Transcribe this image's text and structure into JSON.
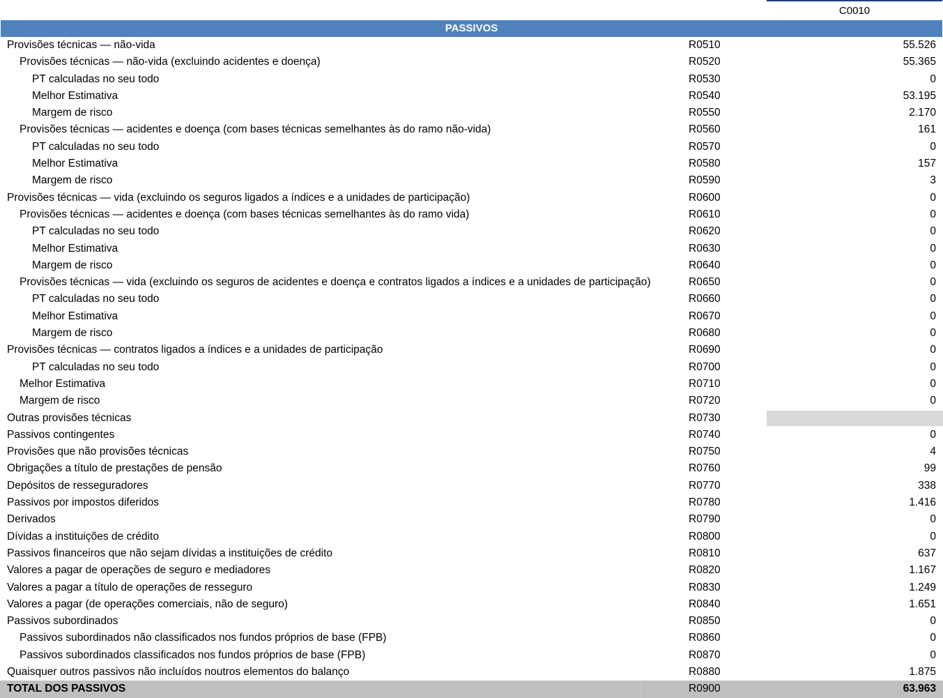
{
  "column_code": "C0010",
  "section_title": "PASSIVOS",
  "rows": [
    {
      "label": "Provisões técnicas — não-vida",
      "level": 0,
      "code": "R0510",
      "value": "55.526"
    },
    {
      "label": "Provisões técnicas — não-vida (excluindo acidentes e doença)",
      "level": 1,
      "code": "R0520",
      "value": "55.365"
    },
    {
      "label": "PT calculadas no seu todo",
      "level": 2,
      "code": "R0530",
      "value": "0"
    },
    {
      "label": "Melhor Estimativa",
      "level": 2,
      "code": "R0540",
      "value": "53.195"
    },
    {
      "label": "Margem de risco",
      "level": 2,
      "code": "R0550",
      "value": "2.170"
    },
    {
      "label": "Provisões técnicas — acidentes e doença (com bases técnicas semelhantes às do ramo não-vida)",
      "level": 1,
      "code": "R0560",
      "value": "161"
    },
    {
      "label": "PT calculadas no seu todo",
      "level": 2,
      "code": "R0570",
      "value": "0"
    },
    {
      "label": "Melhor Estimativa",
      "level": 2,
      "code": "R0580",
      "value": "157"
    },
    {
      "label": "Margem de risco",
      "level": 2,
      "code": "R0590",
      "value": "3"
    },
    {
      "label": "Provisões técnicas — vida (excluindo os seguros ligados a índices e a unidades de participação)",
      "level": 0,
      "code": "R0600",
      "value": "0"
    },
    {
      "label": "Provisões técnicas — acidentes e doença (com bases técnicas semelhantes às do ramo vida)",
      "level": 1,
      "code": "R0610",
      "value": "0"
    },
    {
      "label": "PT calculadas no seu todo",
      "level": 2,
      "code": "R0620",
      "value": "0"
    },
    {
      "label": "Melhor Estimativa",
      "level": 2,
      "code": "R0630",
      "value": "0"
    },
    {
      "label": "Margem de risco",
      "level": 2,
      "code": "R0640",
      "value": "0"
    },
    {
      "label": "Provisões técnicas — vida (excluindo os seguros de acidentes e doença e contratos ligados a índices e a unidades de participação)",
      "level": 1,
      "code": "R0650",
      "value": "0"
    },
    {
      "label": "PT calculadas no seu todo",
      "level": 2,
      "code": "R0660",
      "value": "0"
    },
    {
      "label": "Melhor Estimativa",
      "level": 2,
      "code": "R0670",
      "value": "0"
    },
    {
      "label": "Margem de risco",
      "level": 2,
      "code": "R0680",
      "value": "0"
    },
    {
      "label": "Provisões técnicas — contratos ligados a índices e a unidades de participação",
      "level": 0,
      "code": "R0690",
      "value": "0"
    },
    {
      "label": "PT calculadas no seu todo",
      "level": 2,
      "code": "R0700",
      "value": "0"
    },
    {
      "label": "Melhor Estimativa",
      "level": 1,
      "code": "R0710",
      "value": "0"
    },
    {
      "label": "Margem de risco",
      "level": 1,
      "code": "R0720",
      "value": "0"
    },
    {
      "label": "Outras provisões técnicas",
      "level": 0,
      "code": "R0730",
      "value": "",
      "grey": true
    },
    {
      "label": "Passivos contingentes",
      "level": 0,
      "code": "R0740",
      "value": "0"
    },
    {
      "label": "Provisões que não provisões técnicas",
      "level": 0,
      "code": "R0750",
      "value": "4"
    },
    {
      "label": "Obrigações a título de prestações de pensão",
      "level": 0,
      "code": "R0760",
      "value": "99"
    },
    {
      "label": "Depósitos de resseguradores",
      "level": 0,
      "code": "R0770",
      "value": "338"
    },
    {
      "label": "Passivos por impostos diferidos",
      "level": 0,
      "code": "R0780",
      "value": "1.416"
    },
    {
      "label": "Derivados",
      "level": 0,
      "code": "R0790",
      "value": "0"
    },
    {
      "label": "Dívidas a instituições de crédito",
      "level": 0,
      "code": "R0800",
      "value": "0"
    },
    {
      "label": "Passivos financeiros que não sejam dívidas a instituições de crédito",
      "level": 0,
      "code": "R0810",
      "value": "637"
    },
    {
      "label": "Valores a pagar de operações de seguro e mediadores",
      "level": 0,
      "code": "R0820",
      "value": "1.167"
    },
    {
      "label": "Valores a pagar a título de operações de resseguro",
      "level": 0,
      "code": "R0830",
      "value": "1.249"
    },
    {
      "label": "Valores a pagar (de operações comerciais, não de seguro)",
      "level": 0,
      "code": "R0840",
      "value": "1.651"
    },
    {
      "label": "Passivos subordinados",
      "level": 0,
      "code": "R0850",
      "value": "0"
    },
    {
      "label": "Passivos subordinados não classificados nos fundos próprios de base (FPB)",
      "level": 1,
      "code": "R0860",
      "value": "0"
    },
    {
      "label": "Passivos subordinados classificados nos fundos próprios de base (FPB)",
      "level": 1,
      "code": "R0870",
      "value": "0"
    },
    {
      "label": "Quaisquer outros passivos não incluídos noutros elementos do balanço",
      "level": 0,
      "code": "R0880",
      "value": "1.875"
    },
    {
      "label": "TOTAL DOS PASSIVOS",
      "level": 0,
      "code": "R0900",
      "value": "63.963",
      "total": true
    }
  ]
}
